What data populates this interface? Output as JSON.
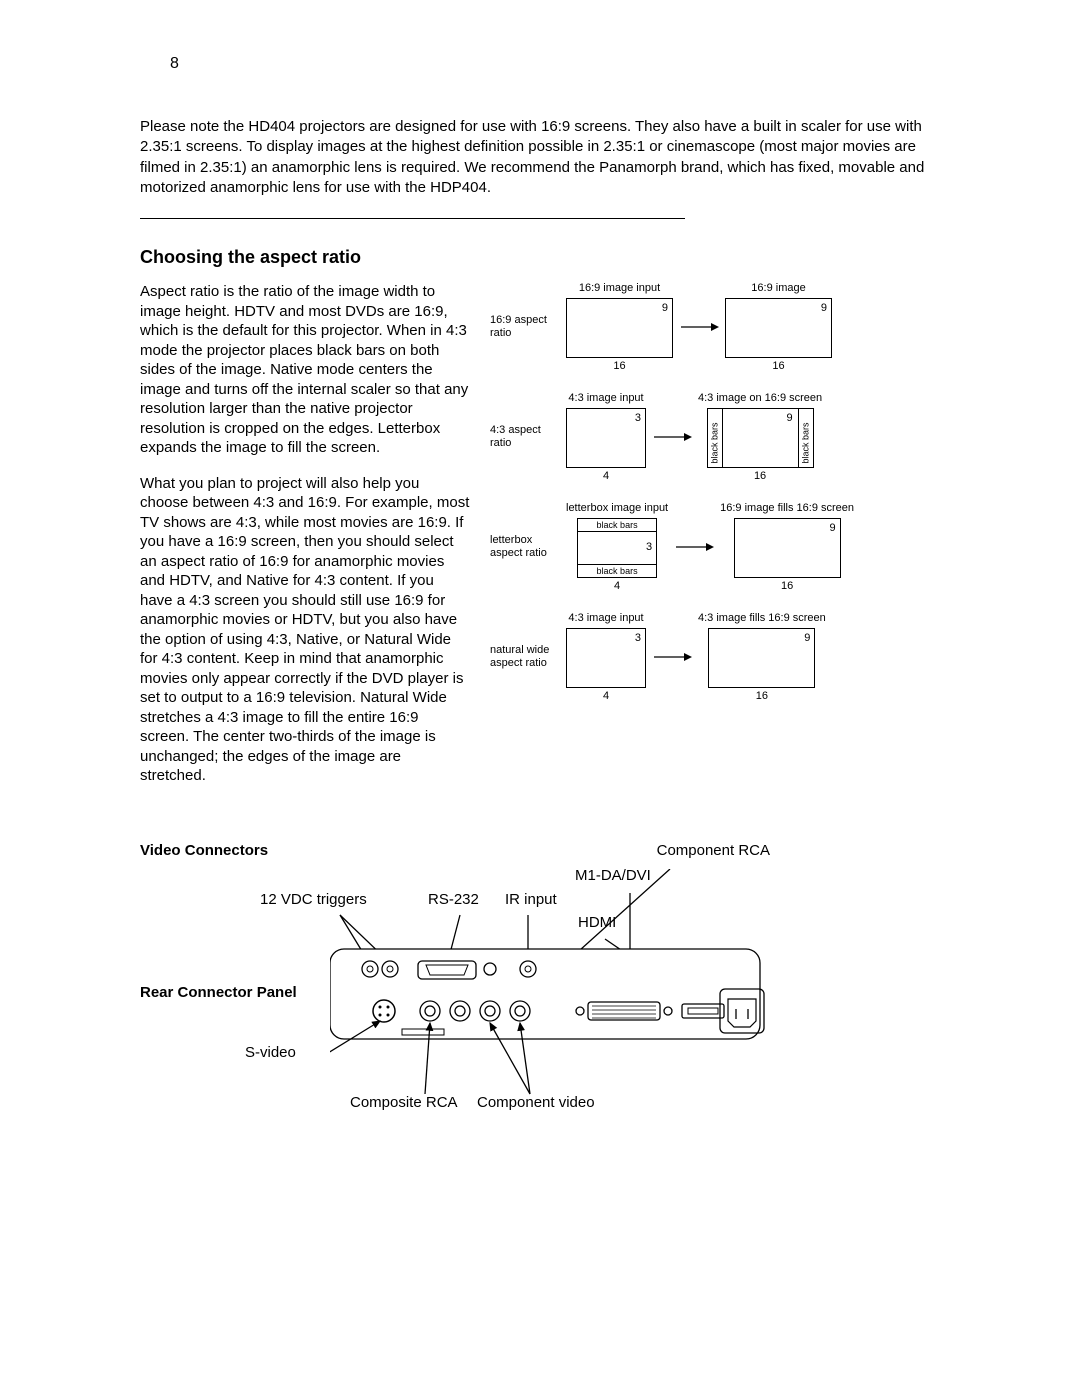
{
  "page_number": "8",
  "intro_paragraph": "Please note the HD404 projectors are designed for use with 16:9 screens. They also have a built in scaler for use with 2.35:1 screens. To display images at the highest definition possible in 2.35:1 or cinemascope (most major movies are filmed in 2.35:1) an anamorphic lens is required. We recommend the Panamorph brand, which has fixed, movable and motorized anamorphic lens for use with the HDP404.",
  "heading_aspect": "Choosing the aspect ratio",
  "para_aspect_1": "Aspect ratio is the ratio of the image width to image height. HDTV and most DVDs are 16:9, which is the default for this projector. When in 4:3 mode the projector places black bars on both sides of the image. Native mode centers the image and turns off the internal scaler so that any resolution larger than the native projector resolution is cropped on the edges. Letterbox expands the image to fill the screen.",
  "para_aspect_2": "What you plan to project will also help you choose between 4:3 and 16:9. For example, most TV shows are 4:3, while most movies are 16:9. If you have a 16:9 screen, then you should select an aspect ratio of 16:9 for anamorphic movies and HDTV, and Native for 4:3 content. If you have a 4:3 screen you should still use 16:9 for anamorphic movies or HDTV, but you also have the option of using 4:3, Native, or Natural Wide for 4:3 content. Keep in mind that anamorphic movies only appear correctly if the DVD player is set to output to a 16:9 television. Natural Wide stretches a 4:3 image to fill the entire 16:9 screen. The center two-thirds of the image is unchanged; the edges of the image are stretched.",
  "diagram": {
    "rows": [
      {
        "label": "16:9 aspect ratio",
        "input_title": "16:9 image input",
        "output_title": "16:9 image",
        "input_w": "16",
        "input_h": "9",
        "output_w": "16",
        "output_h": "9"
      },
      {
        "label": "4:3 aspect ratio",
        "input_title": "4:3 image input",
        "output_title": "4:3 image on 16:9 screen",
        "input_w": "4",
        "input_h": "3",
        "output_w": "16",
        "output_h": "9",
        "black_bars_v": "black bars"
      },
      {
        "label": "letterbox aspect ratio",
        "input_title": "letterbox image input",
        "output_title": "16:9 image fills 16:9 screen",
        "input_w": "4",
        "input_h": "3",
        "output_w": "16",
        "output_h": "9",
        "black_bars_h": "black bars"
      },
      {
        "label": "natural wide aspect ratio",
        "input_title": "4:3 image input",
        "output_title": "4:3 image fills 16:9 screen",
        "input_w": "4",
        "input_h": "3",
        "output_w": "16",
        "output_h": "9"
      }
    ]
  },
  "video_connectors": {
    "title": "Video Connectors",
    "rear_title": "Rear Connector Panel",
    "labels": {
      "component_rca": "Component RCA",
      "m1": "M1-DA/DVI",
      "triggers": "12 VDC triggers",
      "rs232": "RS-232",
      "ir": "IR input",
      "hdmi": "HDMI",
      "svideo": "S-video",
      "composite": "Composite RCA",
      "component_video": "Component video"
    }
  }
}
